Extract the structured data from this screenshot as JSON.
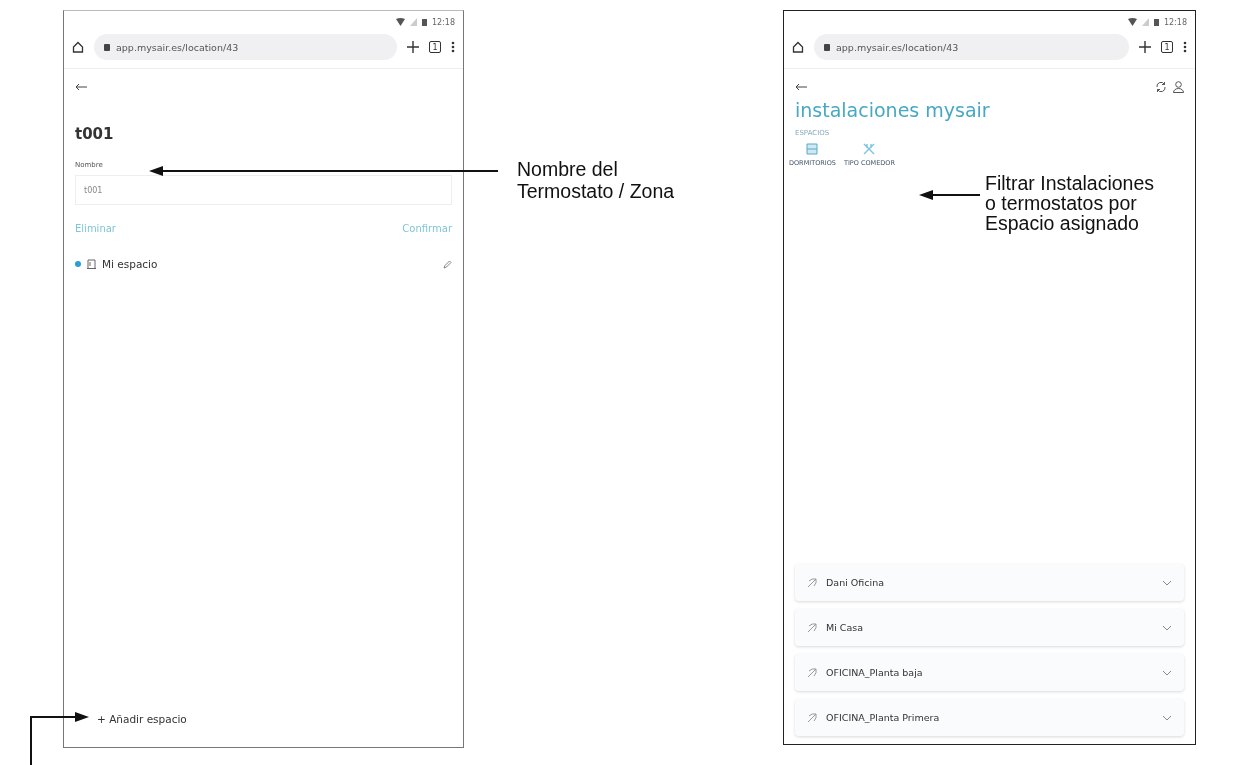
{
  "left_screen": {
    "status_time": "12:18",
    "url": "app.mysair.es/location/43",
    "tab_count": "1",
    "title": "t001",
    "field": {
      "label": "Nombre",
      "value": "t001"
    },
    "actions": [
      "Eliminar",
      "Confirmar"
    ],
    "spaces": [
      {
        "name": "Mi espacio",
        "color": "#2a9fd6"
      }
    ],
    "add_button": "+ Añadir espacio"
  },
  "right_screen": {
    "status_time": "12:18",
    "url": "app.mysair.es/location/43",
    "tab_count": "1",
    "title": "instalaciones mysair",
    "section_label": "ESPACIOS",
    "filters": [
      {
        "label": "DORMITORIOS",
        "kind": "bed"
      },
      {
        "label": "TIPO COMEDOR",
        "kind": "dining"
      }
    ],
    "installations": [
      {
        "name": "Dani Oficina",
        "expanded": false
      },
      {
        "name": "Mi Casa",
        "expanded": false
      },
      {
        "name": "OFICINA_Planta baja",
        "expanded": false
      },
      {
        "name": "OFICINA_Planta Primera",
        "expanded": false
      }
    ]
  },
  "annotations": [
    {
      "lines": [
        "Nombre del",
        "Termostato / Zona"
      ]
    },
    {
      "lines": [
        "Filtrar Instalaciones",
        "o termostatos por",
        "Espacio asignado"
      ]
    }
  ]
}
